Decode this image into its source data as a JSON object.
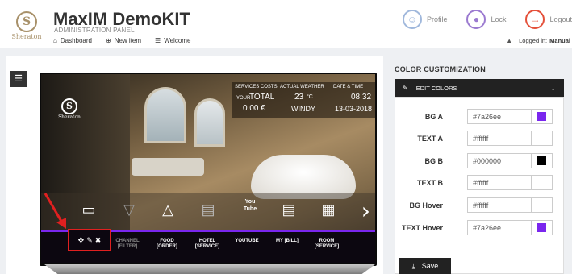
{
  "brand": {
    "logo_letter": "S",
    "logo_word": "Sheraton",
    "title": "MaxIM DemoKIT",
    "subtitle": "ADMINISTRATION PANEL"
  },
  "nav": [
    {
      "label": "Dashboard",
      "icon": "home-icon"
    },
    {
      "label": "New item",
      "icon": "plus-circle-icon"
    },
    {
      "label": "Welcome",
      "icon": "list-icon"
    }
  ],
  "header_actions": [
    {
      "label": "Profile",
      "icon": "profile-icon"
    },
    {
      "label": "Lock",
      "icon": "lock-icon"
    },
    {
      "label": "Logout",
      "icon": "logout-icon"
    }
  ],
  "logged_in": {
    "label": "Logged in:",
    "user": "Manual"
  },
  "tv": {
    "info": {
      "services_costs_label": "SERVICES COSTS",
      "actual_weather_label": "ACTUAL WEATHER",
      "date_time_label": "DATE & TIME",
      "your_label": "YOUR",
      "total_label": "TOTAL",
      "total_value": "0.00 €",
      "temperature": "23",
      "temp_unit": "°C",
      "weather": "WINDY",
      "time": "08:32",
      "date": "13-03-2018"
    },
    "icons": [
      "tv-icon",
      "filter-icon",
      "food-dome-icon",
      "hotel-service-icon",
      "youtube-icon",
      "bill-icon",
      "bed-icon"
    ],
    "youtube_text": {
      "top": "You",
      "bottom": "Tube"
    },
    "channels": [
      {
        "line1": "CHANNEL",
        "line2": "[FILTER]"
      },
      {
        "line1": "FOOD",
        "line2": "[ORDER]"
      },
      {
        "line1": "HOTEL",
        "line2": "[SERVICE]"
      },
      {
        "line1": "YOUTUBE",
        "line2": ""
      },
      {
        "line1": "MY [BILL]",
        "line2": ""
      },
      {
        "line1": "ROOM",
        "line2": "[SERVICE]"
      }
    ],
    "accent_color": "#7a26ee"
  },
  "color_customization": {
    "title": "COLOR CUSTOMIZATION",
    "edit_label": "EDIT COLORS",
    "fields": [
      {
        "label": "BG A",
        "value": "#7a26ee",
        "swatch": "#7a26ee"
      },
      {
        "label": "TEXT A",
        "value": "#ffffff",
        "swatch": "#ffffff"
      },
      {
        "label": "BG B",
        "value": "#000000",
        "swatch": "#000000"
      },
      {
        "label": "TEXT B",
        "value": "#ffffff",
        "swatch": "#ffffff"
      },
      {
        "label": "BG Hover",
        "value": "#ffffff",
        "swatch": "#ffffff"
      },
      {
        "label": "TEXT Hover",
        "value": "#7a26ee",
        "swatch": "#7a26ee"
      }
    ],
    "save_label": "Save"
  }
}
